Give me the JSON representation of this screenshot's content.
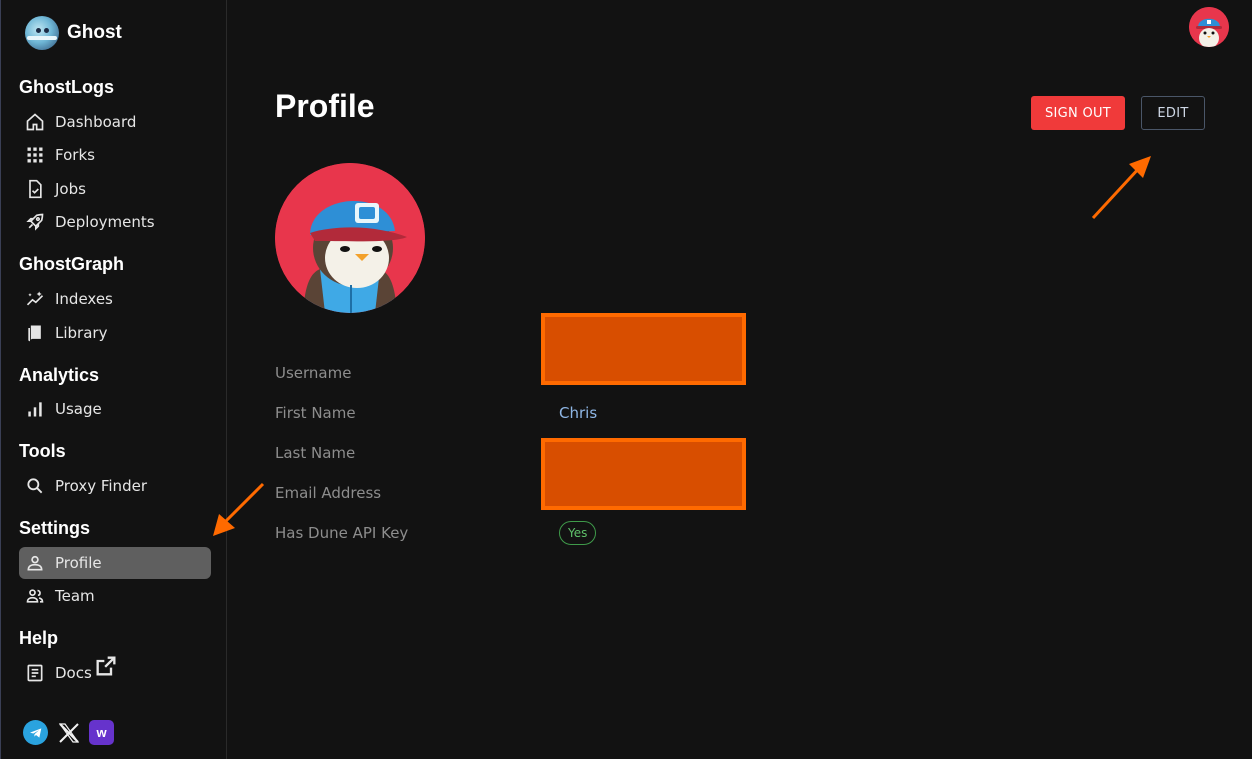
{
  "brand": {
    "name": "Ghost"
  },
  "sidebar": {
    "sections": [
      {
        "title": "GhostLogs",
        "items": [
          {
            "label": "Dashboard",
            "icon": "home-icon"
          },
          {
            "label": "Forks",
            "icon": "grid-icon"
          },
          {
            "label": "Jobs",
            "icon": "file-check-icon"
          },
          {
            "label": "Deployments",
            "icon": "rocket-icon"
          }
        ]
      },
      {
        "title": "GhostGraph",
        "items": [
          {
            "label": "Indexes",
            "icon": "sparkle-chart-icon"
          },
          {
            "label": "Library",
            "icon": "book-icon"
          }
        ]
      },
      {
        "title": "Analytics",
        "items": [
          {
            "label": "Usage",
            "icon": "bar-chart-icon"
          }
        ]
      },
      {
        "title": "Tools",
        "items": [
          {
            "label": "Proxy Finder",
            "icon": "search-icon"
          }
        ]
      },
      {
        "title": "Settings",
        "items": [
          {
            "label": "Profile",
            "icon": "person-icon",
            "active": true
          },
          {
            "label": "Team",
            "icon": "people-icon"
          }
        ]
      },
      {
        "title": "Help",
        "items": [
          {
            "label": "Docs",
            "icon": "document-icon",
            "external": true
          }
        ]
      }
    ],
    "socials": [
      {
        "icon": "telegram-icon"
      },
      {
        "icon": "x-icon"
      },
      {
        "icon": "warpcast-icon",
        "glyph": "w"
      }
    ]
  },
  "header": {
    "title": "Profile",
    "signout_label": "SIGN OUT",
    "edit_label": "EDIT"
  },
  "profile": {
    "fields": [
      {
        "label": "Username",
        "value": ""
      },
      {
        "label": "First Name",
        "value": "Chris"
      },
      {
        "label": "Last Name",
        "value": ""
      },
      {
        "label": "Email Address",
        "value": ""
      },
      {
        "label": "Has Dune API Key",
        "value": "Yes"
      }
    ]
  },
  "colors": {
    "accent_red": "#f03a3a",
    "active_nav": "#5f5f5f",
    "value_blue": "#8fb7e6",
    "badge_green": "#5fc16a",
    "annotation_orange": "#ff6a00"
  }
}
